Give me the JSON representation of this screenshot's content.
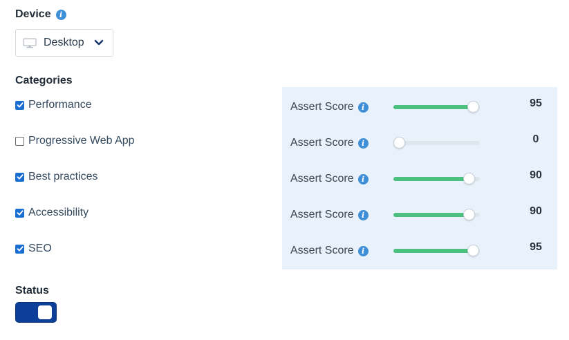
{
  "device": {
    "title": "Device",
    "info_icon": "info-icon",
    "selected": "Desktop"
  },
  "categories": {
    "title": "Categories",
    "items": [
      {
        "label": "Performance",
        "checked": true
      },
      {
        "label": "Progressive Web App",
        "checked": false
      },
      {
        "label": "Best practices",
        "checked": true
      },
      {
        "label": "Accessibility",
        "checked": true
      },
      {
        "label": "SEO",
        "checked": true
      }
    ]
  },
  "assert_scores": [
    {
      "label": "Assert Score",
      "value": "95",
      "level": 0.95
    },
    {
      "label": "Assert Score",
      "value": "0",
      "level": 0
    },
    {
      "label": "Assert Score",
      "value": "90",
      "level": 0.9
    },
    {
      "label": "Assert Score",
      "value": "90",
      "level": 0.9
    },
    {
      "label": "Assert Score",
      "value": "95",
      "level": 0.95
    }
  ],
  "status": {
    "title": "Status",
    "enabled": true
  },
  "colors": {
    "accent": "#1a6fd1",
    "slider_fill": "#4cc07f",
    "toggle_on": "#0d3f99",
    "panel_bg": "#e9f1fb",
    "info_icon": "#3f8fd6"
  }
}
